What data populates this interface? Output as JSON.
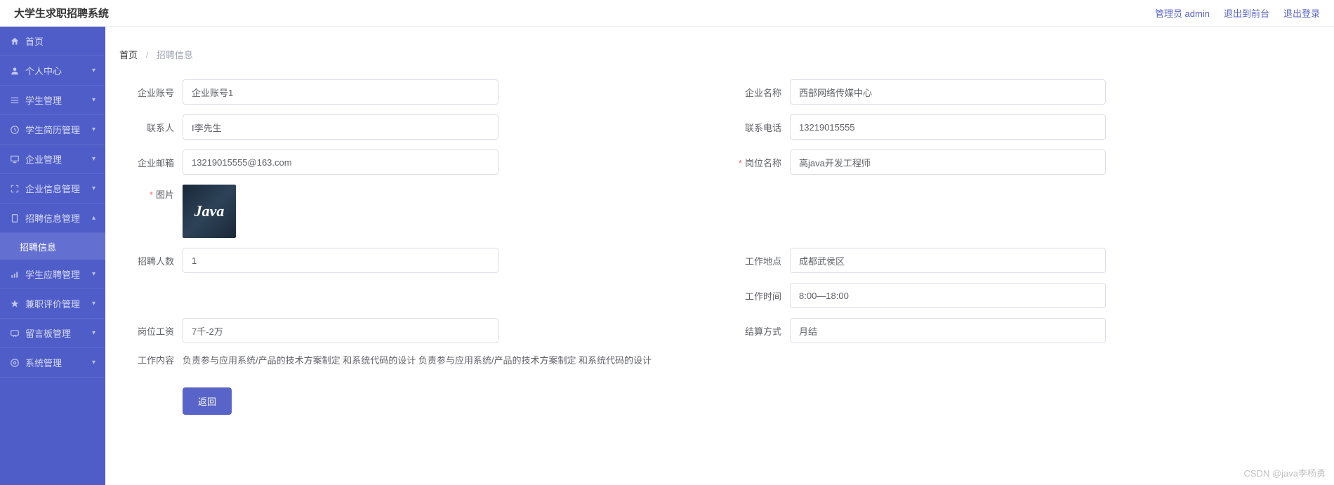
{
  "header": {
    "title": "大学生求职招聘系统",
    "user_label": "管理员 admin",
    "exit_front": "退出到前台",
    "logout": "退出登录"
  },
  "sidebar": {
    "items": [
      {
        "label": "首页",
        "icon": "home",
        "expandable": false
      },
      {
        "label": "个人中心",
        "icon": "user",
        "expandable": true
      },
      {
        "label": "学生管理",
        "icon": "menu",
        "expandable": true
      },
      {
        "label": "学生简历管理",
        "icon": "clock",
        "expandable": true
      },
      {
        "label": "企业管理",
        "icon": "monitor",
        "expandable": true
      },
      {
        "label": "企业信息管理",
        "icon": "expand",
        "expandable": true
      },
      {
        "label": "招聘信息管理",
        "icon": "file",
        "expandable": true,
        "expanded": true
      },
      {
        "label": "学生应聘管理",
        "icon": "chart",
        "expandable": true
      },
      {
        "label": "兼职评价管理",
        "icon": "star",
        "expandable": true
      },
      {
        "label": "留言板管理",
        "icon": "message",
        "expandable": true
      },
      {
        "label": "系统管理",
        "icon": "gear",
        "expandable": true
      }
    ],
    "subitem": "招聘信息"
  },
  "breadcrumb": {
    "home": "首页",
    "current": "招聘信息"
  },
  "form": {
    "company_account_label": "企业账号",
    "company_account_value": "企业账号1",
    "company_name_label": "企业名称",
    "company_name_value": "西部网络传媒中心",
    "contact_label": "联系人",
    "contact_value": "I李先生",
    "phone_label": "联系电话",
    "phone_value": "13219015555",
    "email_label": "企业邮箱",
    "email_value": "13219015555@163.com",
    "position_label": "岗位名称",
    "position_value": "高java开发工程师",
    "image_label": "图片",
    "image_text": "Java",
    "headcount_label": "招聘人数",
    "headcount_value": "1",
    "location_label": "工作地点",
    "location_value": "成都武侯区",
    "worktime_label": "工作时间",
    "worktime_value": "8:00—18:00",
    "salary_label": "岗位工资",
    "salary_value": "7千-2万",
    "settle_label": "结算方式",
    "settle_value": "月结",
    "content_label": "工作内容",
    "content_value": "负责参与应用系统/产品的技术方案制定 和系统代码的设计 负责参与应用系统/产品的技术方案制定 和系统代码的设计",
    "back_button": "返回"
  },
  "watermark": "CSDN @java李杨勇"
}
